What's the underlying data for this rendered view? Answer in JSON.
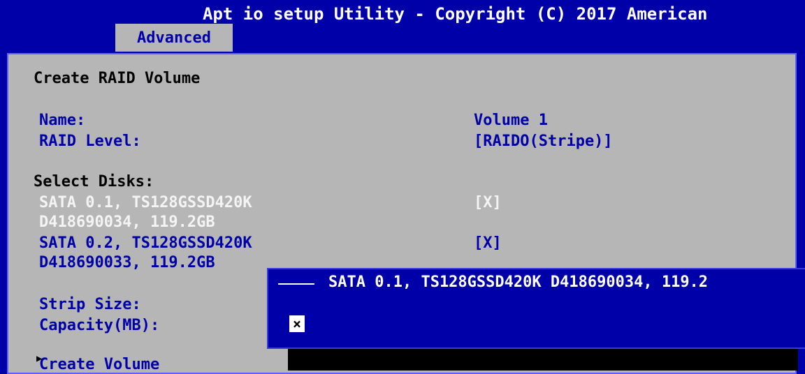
{
  "header": {
    "title": "Apt io setup Utility - Copyright (C) 2017 American",
    "active_tab": "Advanced"
  },
  "form": {
    "heading": "Create RAID Volume",
    "name_label": "Name:",
    "name_value": "Volume 1",
    "raid_level_label": "RAID Level:",
    "raid_level_value": "[RAIDO(Stripe)]",
    "select_disks_label": "Select Disks:",
    "disks": [
      {
        "line1": "SATA 0.1, TS128GSSD420K",
        "line2": "D418690034, 119.2GB",
        "checkbox": "[X]"
      },
      {
        "line1": "SATA 0.2, TS128GSSD420K",
        "line2": "D418690033, 119.2GB",
        "checkbox": "[X]"
      }
    ],
    "strip_size_label": "Strip Size:",
    "capacity_label": "Capacity(MB):",
    "create_volume_label": "Create Volume"
  },
  "popup": {
    "title": "SATA 0.1, TS128GSSD420K D418690034, 119.2",
    "check_mark": "×"
  },
  "colors": {
    "background": "#0000a8",
    "panel": "#b6b6b6",
    "highlight_text": "#f4f4f4"
  }
}
